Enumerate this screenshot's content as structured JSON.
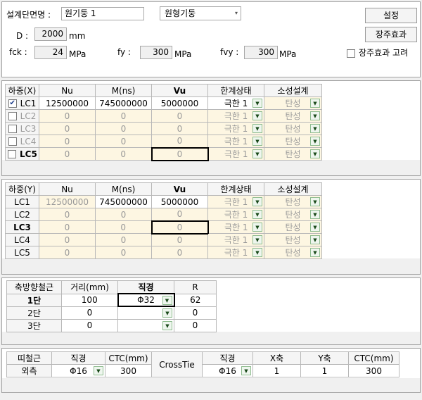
{
  "section": {
    "name_label": "설계단면명 :",
    "name_value": "원기둥 1",
    "shape_selected": "원형기둥",
    "setting_button": "설정",
    "long_column_button": "장주효과",
    "long_column_check_label": "장주효과 고려",
    "d_label": "D :",
    "d_value": "2000",
    "d_unit": "mm",
    "fck_label": "fck :",
    "fck_value": "24",
    "fck_unit": "MPa",
    "fy_label": "fy :",
    "fy_value": "300",
    "fy_unit": "MPa",
    "fvy_label": "fvy :",
    "fvy_value": "300",
    "fvy_unit": "MPa"
  },
  "load_x": {
    "headers": [
      "하중(X)",
      "Nu",
      "M(ns)",
      "Vu",
      "한계상태",
      "소성설계"
    ],
    "rows": [
      {
        "label": "LC1",
        "checked": "✔",
        "nu": "12500000",
        "m": "745000000",
        "vu": "5000000",
        "limit": "극한 1",
        "plastic": "탄성"
      },
      {
        "label": "LC2",
        "checked": "",
        "nu": "0",
        "m": "0",
        "vu": "0",
        "limit": "극한 1",
        "plastic": "탄성"
      },
      {
        "label": "LC3",
        "checked": "",
        "nu": "0",
        "m": "0",
        "vu": "0",
        "limit": "극한 1",
        "plastic": "탄성"
      },
      {
        "label": "LC4",
        "checked": "",
        "nu": "0",
        "m": "0",
        "vu": "0",
        "limit": "극한 1",
        "plastic": "탄성"
      },
      {
        "label": "LC5",
        "checked": "",
        "nu": "0",
        "m": "0",
        "vu": "0",
        "limit": "극한 1",
        "plastic": "탄성"
      }
    ]
  },
  "load_y": {
    "headers": [
      "하중(Y)",
      "Nu",
      "M(ns)",
      "Vu",
      "한계상태",
      "소성설계"
    ],
    "rows": [
      {
        "label": "LC1",
        "nu": "12500000",
        "m": "745000000",
        "vu": "5000000",
        "limit": "극한 1",
        "plastic": "탄성"
      },
      {
        "label": "LC2",
        "nu": "0",
        "m": "0",
        "vu": "0",
        "limit": "극한 1",
        "plastic": "탄성"
      },
      {
        "label": "LC3",
        "nu": "0",
        "m": "0",
        "vu": "0",
        "limit": "극한 1",
        "plastic": "탄성"
      },
      {
        "label": "LC4",
        "nu": "0",
        "m": "0",
        "vu": "0",
        "limit": "극한 1",
        "plastic": "탄성"
      },
      {
        "label": "LC5",
        "nu": "0",
        "m": "0",
        "vu": "0",
        "limit": "극한 1",
        "plastic": "탄성"
      }
    ]
  },
  "axial_rebar": {
    "headers": [
      "축방향철근",
      "거리(mm)",
      "직경",
      "R"
    ],
    "rows": [
      {
        "label": "1단",
        "dist": "100",
        "dia": "Φ32",
        "r": "62"
      },
      {
        "label": "2단",
        "dist": "0",
        "dia": "",
        "r": "0"
      },
      {
        "label": "3단",
        "dist": "0",
        "dia": "",
        "r": "0"
      }
    ]
  },
  "tie": {
    "headers": [
      "띠철근",
      "직경",
      "CTC(mm)",
      "CrossTie",
      "직경",
      "X축",
      "Y축",
      "CTC(mm)"
    ],
    "row_label": "외측",
    "dia": "Φ16",
    "ctc": "300",
    "cross_label": "CrossTie",
    "cross_dia": "Φ16",
    "x_count": "1",
    "y_count": "1",
    "cross_ctc": "300"
  },
  "icons": {
    "dropdown": "▼",
    "combo_arrow": "▾"
  }
}
